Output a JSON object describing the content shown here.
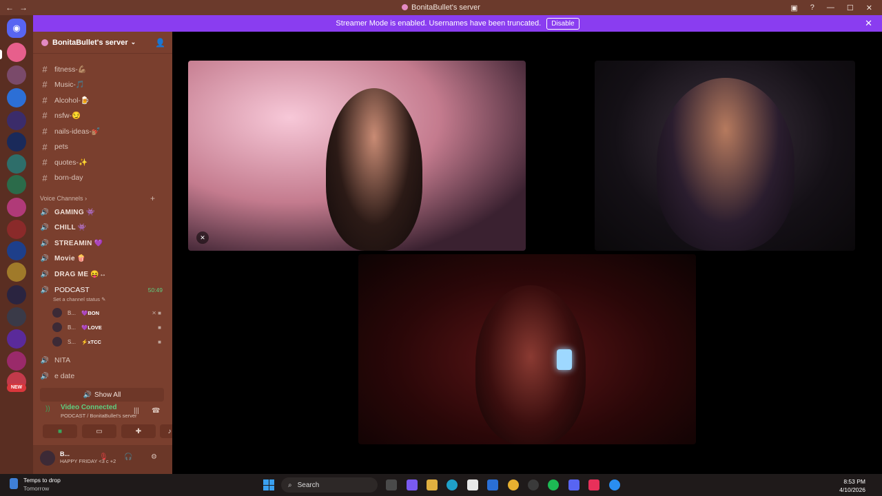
{
  "window": {
    "title": "BonitaBullet's server"
  },
  "banner": {
    "text": "Streamer Mode is enabled. Usernames have been truncated.",
    "button": "Disable"
  },
  "server": {
    "name": "BonitaBullet's server"
  },
  "text_channels": [
    {
      "name": "fitness-💪🏽"
    },
    {
      "name": "Music-🎵"
    },
    {
      "name": "Alcohol-🍺"
    },
    {
      "name": "nsfw-😏"
    },
    {
      "name": "nails-ideas-💅🏽"
    },
    {
      "name": "pets"
    },
    {
      "name": "quotes-✨"
    },
    {
      "name": "born-day"
    }
  ],
  "voice_category": "Voice Channels",
  "voice_channels": [
    {
      "name": "GAMING 👾"
    },
    {
      "name": "CHILL 👾"
    },
    {
      "name": "STREAMIN 💜"
    },
    {
      "name": "Movie 🍿"
    },
    {
      "name": "DRAG ME 😝↔"
    }
  ],
  "podcast": {
    "name": "PODCAST",
    "time": "50:49",
    "status": "Set a channel status",
    "users": [
      {
        "name": "B...",
        "tag": "💜BON"
      },
      {
        "name": "B...",
        "tag": "💜LOVE"
      },
      {
        "name": "S...",
        "tag": "⚡xTCC"
      }
    ]
  },
  "more_channels": [
    {
      "name": "NITA"
    },
    {
      "name": "e date"
    }
  ],
  "show_all": "Show All",
  "voice_connection": {
    "label": "Video Connected",
    "detail": "PODCAST / BonitaBullet's server"
  },
  "user": {
    "name": "B...",
    "status": "HAPPY FRIDAY <3 c +2"
  },
  "taskbar": {
    "weather_title": "Temps to drop",
    "weather_sub": "Tomorrow",
    "search": "Search",
    "time": "8:53 PM",
    "date": "4/10/2026"
  },
  "colors": {
    "accent": "#8a3df0",
    "sidebar": "#7a3f2e",
    "connected": "#5fcf80"
  }
}
